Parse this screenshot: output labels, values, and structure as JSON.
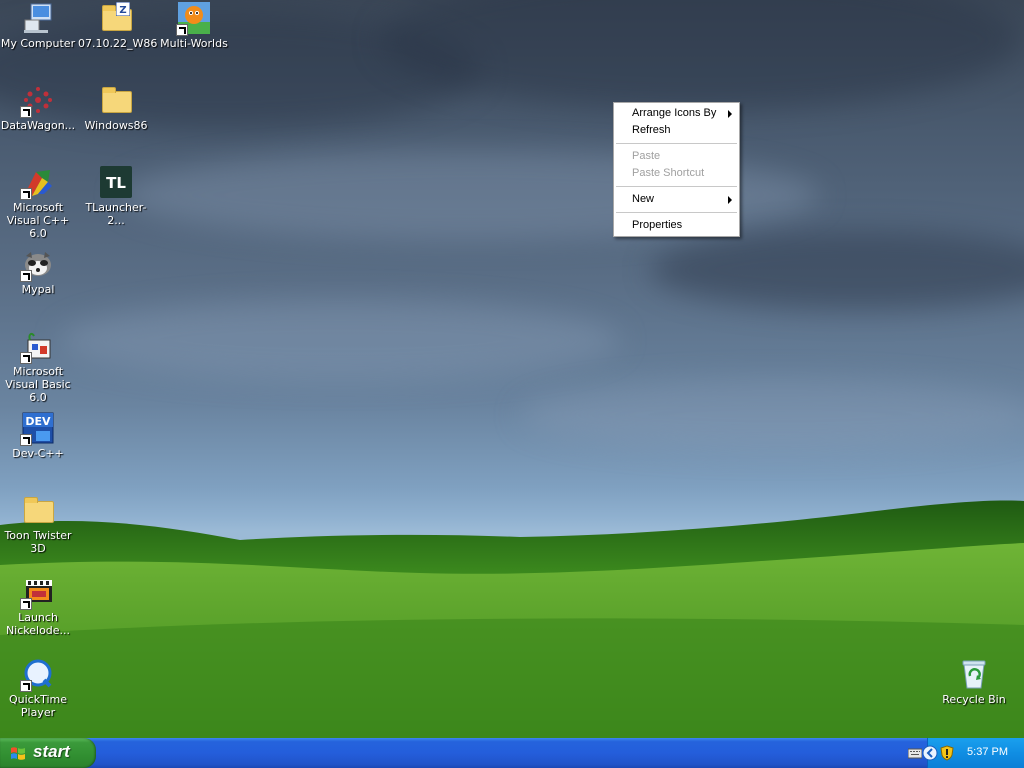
{
  "desktop_icons": [
    {
      "label": "My Computer",
      "icon": "my-computer-icon"
    },
    {
      "label": "07.10.22_W86",
      "icon": "zip-folder-icon"
    },
    {
      "label": "Multi-Worlds",
      "icon": "multi-worlds-icon"
    },
    {
      "label": "DataWagon...",
      "icon": "datawagon-icon"
    },
    {
      "label": "Windows86",
      "icon": "folder-icon"
    },
    {
      "label": "Microsoft Visual C++ 6.0",
      "icon": "visual-cpp-icon"
    },
    {
      "label": "TLauncher-2...",
      "icon": "tlauncher-icon",
      "badge": "TL"
    },
    {
      "label": "Mypal",
      "icon": "mypal-icon"
    },
    {
      "label": "Microsoft Visual Basic 6.0",
      "icon": "visual-basic-icon"
    },
    {
      "label": "Dev-C++",
      "icon": "dev-cpp-icon",
      "badge": "DEV"
    },
    {
      "label": "Toon Twister 3D",
      "icon": "folder-icon"
    },
    {
      "label": "Launch Nickelode...",
      "icon": "nickelodeon-icon"
    },
    {
      "label": "QuickTime Player",
      "icon": "quicktime-icon"
    },
    {
      "label": "Recycle Bin",
      "icon": "recycle-bin-icon"
    }
  ],
  "context_menu": {
    "items": [
      {
        "label": "Arrange Icons By",
        "submenu": true,
        "enabled": true
      },
      {
        "label": "Refresh",
        "submenu": false,
        "enabled": true
      },
      {
        "label": "Paste",
        "submenu": false,
        "enabled": false
      },
      {
        "label": "Paste Shortcut",
        "submenu": false,
        "enabled": false
      },
      {
        "label": "New",
        "submenu": true,
        "enabled": true
      },
      {
        "label": "Properties",
        "submenu": false,
        "enabled": true
      }
    ]
  },
  "taskbar": {
    "start_label": "start",
    "clock": "5:37 PM",
    "tray_icons": [
      "keyboard-icon",
      "show-hidden-icons-chevron-icon",
      "security-shield-icon"
    ]
  },
  "colors": {
    "taskbar_blue": "#245edb",
    "start_green": "#3b9a3b",
    "tray_blue": "#108ee3",
    "grass_green": "#3f8f1f"
  }
}
